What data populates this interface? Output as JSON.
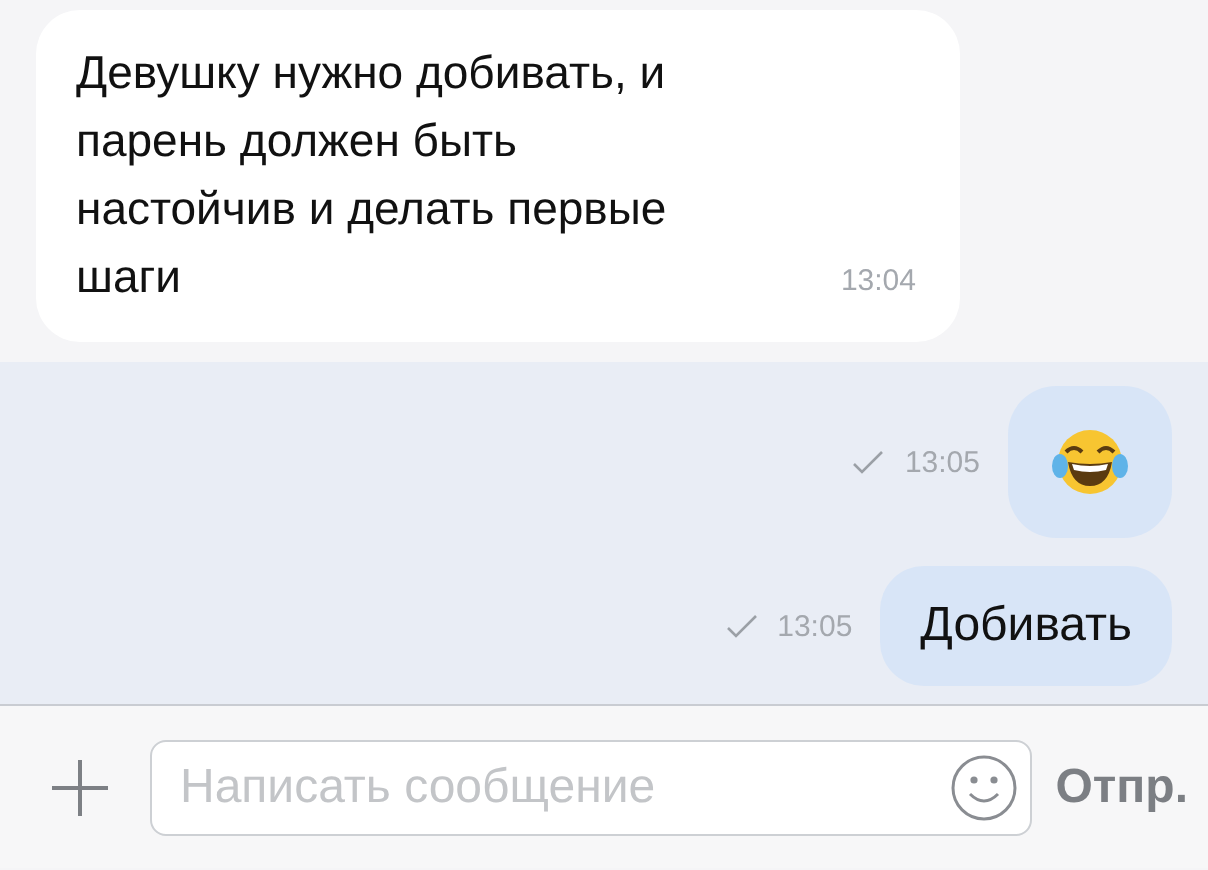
{
  "messages": [
    {
      "kind": "text",
      "outgoing": false,
      "text": "Девушку нужно добивать, и парень должен быть настойчив и делать первые шаги",
      "time": "13:04",
      "sent": false
    },
    {
      "kind": "emoji",
      "outgoing": true,
      "time": "13:05",
      "sent": true
    },
    {
      "kind": "text",
      "outgoing": true,
      "text": "Добивать",
      "time": "13:05",
      "sent": true
    }
  ],
  "composer": {
    "placeholder": "Написать сообщение",
    "send_label": "Отпр."
  }
}
